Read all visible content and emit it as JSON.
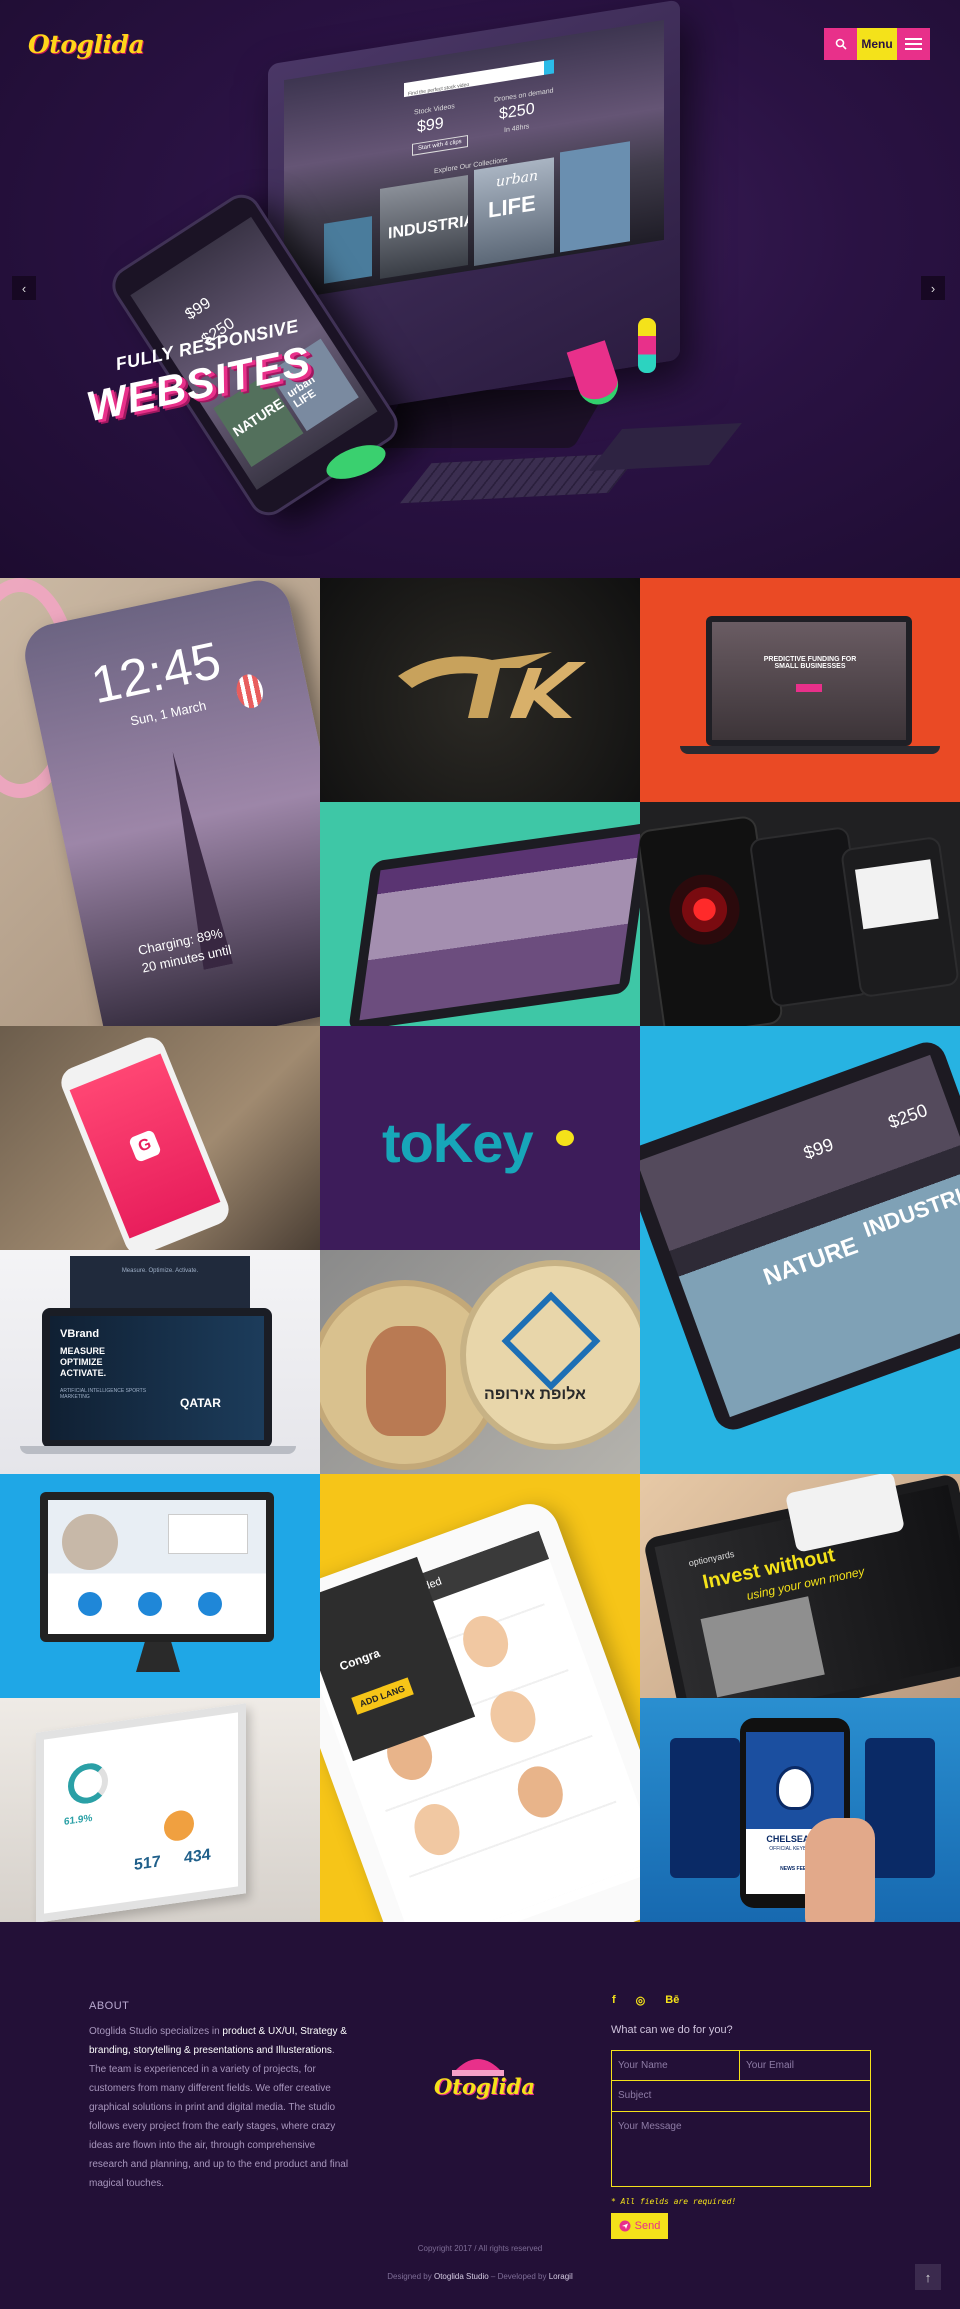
{
  "header": {
    "logo": "Otoglida",
    "menu_label": "Menu",
    "prev": "‹",
    "next": "›"
  },
  "hero": {
    "headline_small": "FULLY RESPONSIVE",
    "headline_big": "WEBSITES",
    "monitor": {
      "search_placeholder": "Find the perfect stock video",
      "price_left_label": "Stock Videos",
      "price_left": "$99",
      "price_left_btn": "Start with 4 clips",
      "price_right_label": "Drones on demand",
      "price_right": "$250",
      "price_right_sub": "In 48hrs",
      "collections_label": "Explore Our Collections",
      "tile1": "INDUSTRIAL",
      "tile2_script": "urban",
      "tile2": "LIFE"
    },
    "phone": {
      "price1": "$99",
      "price2": "$250",
      "tile": "NATURE",
      "tile2": "urban LIFE"
    }
  },
  "portfolio": {
    "lockscreen_time": "12:45",
    "lockscreen_date": "Sun, 1 March",
    "lockscreen_charging": "Charging: 89%",
    "lockscreen_charging2": "20 minutes until",
    "laptop_headline": "PREDICTIVE FUNDING FOR SMALL BUSINESSES",
    "tokey_logo": "toKey",
    "brand_headline": "MEASURE OPTIMIZE ACTIVATE.",
    "brand_name": "VBrand",
    "brand_sub": "ARTIFICIAL INTELLIGENCE SPORTS MARKETING",
    "brand_tag": "QATAR",
    "brand_top": "Measure. Optimize. Activate.",
    "hebrew1": "אלופת אירופה",
    "optionyards_logo": "optionyards",
    "optionyards_head": "Invest without",
    "optionyards_sub": "using your own money",
    "chelsea_title": "CHELSEA FC",
    "chelsea_sub": "OFFICIAL KEYBOARD",
    "chelsea_btn": "NEWS FEED",
    "stats_a": "61.9%",
    "stats_b": "517",
    "stats_c": "434",
    "sticker_title": "Downloaded",
    "sticker_congrats": "Congra",
    "sticker_btn": "ADD LANG"
  },
  "footer": {
    "about_heading": "ABOUT",
    "about_1": "Otoglida Studio specializes in ",
    "about_b1": "product & UX/UI, Strategy & branding, storytelling & presentations and Illusterations",
    "about_2": ". The team is experienced in a variety of projects, for customers from many different fields. We offer creative graphical solutions in print and digital media. The studio follows every project from the early stages, where crazy ideas are flown into the air, through comprehensive research and planning, and up to the end product and final magical touches.",
    "logo": "Otoglida",
    "social": [
      "f",
      "◎",
      "Bē"
    ],
    "form_heading": "What can we do for you?",
    "name_placeholder": "Your Name",
    "email_placeholder": "Your Email",
    "subject_placeholder": "Subject",
    "message_placeholder": "Your Message",
    "required_note": "* All fields are required!",
    "send_label": "Send",
    "copyright": "Copyright 2017 / All rights reserved",
    "designed_by": "Designed by ",
    "designed_name": "Otoglida Studio",
    "developed_by": " – Developed by ",
    "developed_name": "Loragil",
    "to_top": "↑"
  },
  "colors": {
    "bg": "#231037",
    "accent_pink": "#e8308a",
    "accent_yellow": "#f4e21a"
  }
}
